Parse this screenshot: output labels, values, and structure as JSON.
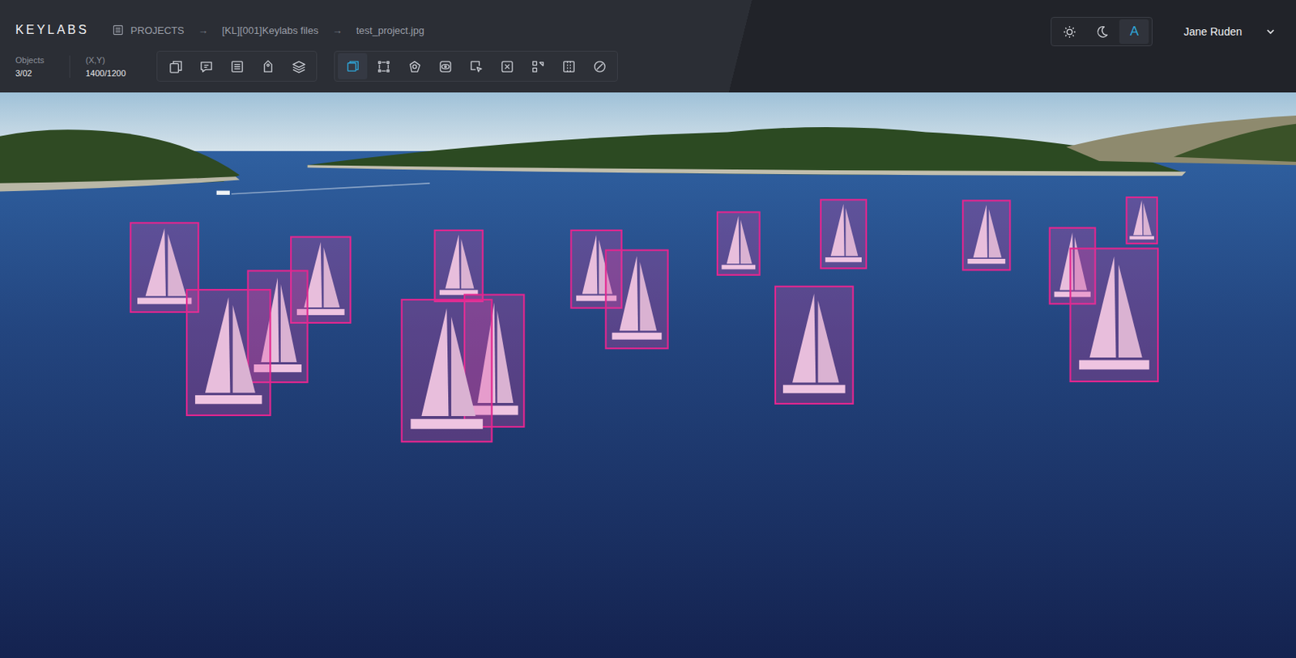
{
  "app": {
    "logo": "KEYLABS"
  },
  "breadcrumb": {
    "separator": "→",
    "items": [
      {
        "label": "PROJECTS"
      },
      {
        "label": "[KL][001]Keylabs files"
      },
      {
        "label": "test_project.jpg"
      }
    ]
  },
  "stats": [
    {
      "label": "Objects",
      "value": "3/02"
    },
    {
      "label": "(X,Y)",
      "value": "1400/1200"
    }
  ],
  "tool_groups": [
    {
      "tools": [
        {
          "kind": "page",
          "selected": false
        },
        {
          "kind": "comment",
          "selected": false
        },
        {
          "kind": "list",
          "selected": false
        },
        {
          "kind": "tag",
          "selected": false
        },
        {
          "kind": "layers",
          "selected": false
        }
      ]
    },
    {
      "tools": [
        {
          "kind": "box",
          "selected": true
        },
        {
          "kind": "points",
          "selected": false
        },
        {
          "kind": "polygon",
          "selected": false
        },
        {
          "kind": "eye",
          "selected": false
        },
        {
          "kind": "cursor-box",
          "selected": false
        },
        {
          "kind": "cursor-x",
          "selected": false
        },
        {
          "kind": "transform",
          "selected": false
        },
        {
          "kind": "grid",
          "selected": false
        },
        {
          "kind": "ellipse",
          "selected": false
        }
      ]
    }
  ],
  "themes": [
    {
      "kind": "light",
      "label": "",
      "selected": false
    },
    {
      "kind": "dark",
      "label": "",
      "selected": false
    },
    {
      "kind": "auto",
      "label": "A",
      "selected": true
    }
  ],
  "user": {
    "name": "Jane Ruden"
  }
}
